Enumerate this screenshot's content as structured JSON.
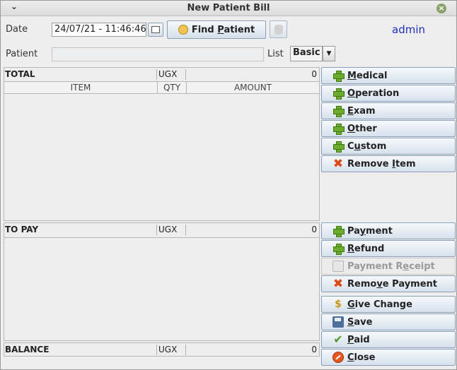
{
  "window": {
    "title": "New Patient Bill",
    "menu_glyph": "⌄",
    "close_glyph": "×"
  },
  "header": {
    "date_label": "Date",
    "date_value": "24/07/21 - 11:46:46",
    "find_patient_label_pre": "Find ",
    "find_patient_label_u": "P",
    "find_patient_label_post": "atient",
    "user": "admin",
    "patient_label": "Patient",
    "patient_value": "",
    "list_label": "List",
    "list_value": "Basic"
  },
  "items_table": {
    "total_label": "TOTAL",
    "currency": "UGX",
    "total_amount": "0",
    "columns": [
      "ITEM",
      "QTY",
      "AMOUNT"
    ],
    "rows": []
  },
  "payments_table": {
    "to_pay_label": "TO PAY",
    "currency": "UGX",
    "to_pay_amount": "0",
    "rows": []
  },
  "balance": {
    "label": "BALANCE",
    "currency": "UGX",
    "amount": "0"
  },
  "item_buttons": [
    {
      "pre": "",
      "u": "M",
      "post": "edical",
      "icon": "plus-icon"
    },
    {
      "pre": "",
      "u": "O",
      "post": "peration",
      "icon": "plus-icon"
    },
    {
      "pre": "",
      "u": "E",
      "post": "xam",
      "icon": "plus-icon"
    },
    {
      "pre": "",
      "u": "O",
      "post": "ther",
      "icon": "plus-icon"
    },
    {
      "pre": "C",
      "u": "u",
      "post": "stom",
      "icon": "plus-icon"
    },
    {
      "pre": "Remove ",
      "u": "I",
      "post": "tem",
      "icon": "x-icon"
    }
  ],
  "payment_buttons": [
    {
      "pre": "Pa",
      "u": "y",
      "post": "ment",
      "icon": "plus-icon"
    },
    {
      "pre": "",
      "u": "R",
      "post": "efund",
      "icon": "plus-icon"
    },
    {
      "pre": "Payment R",
      "u": "e",
      "post": "ceipt",
      "icon": "printer-icon"
    },
    {
      "pre": "Remo",
      "u": "v",
      "post": "e Payment",
      "icon": "x-icon"
    }
  ],
  "action_buttons": [
    {
      "pre": "",
      "u": "G",
      "post": "ive Change",
      "icon": "coins-icon"
    },
    {
      "pre": "",
      "u": "S",
      "post": "ave",
      "icon": "save-icon"
    },
    {
      "pre": "",
      "u": "P",
      "post": "aid",
      "icon": "check-icon"
    },
    {
      "pre": "",
      "u": "C",
      "post": "lose",
      "icon": "no-entry-icon"
    }
  ],
  "colors": {
    "button_border": "#8aa0b8",
    "user_label": "#1f2fb8",
    "plus_green": "#6cab2e",
    "remove_orange": "#e04a12"
  }
}
